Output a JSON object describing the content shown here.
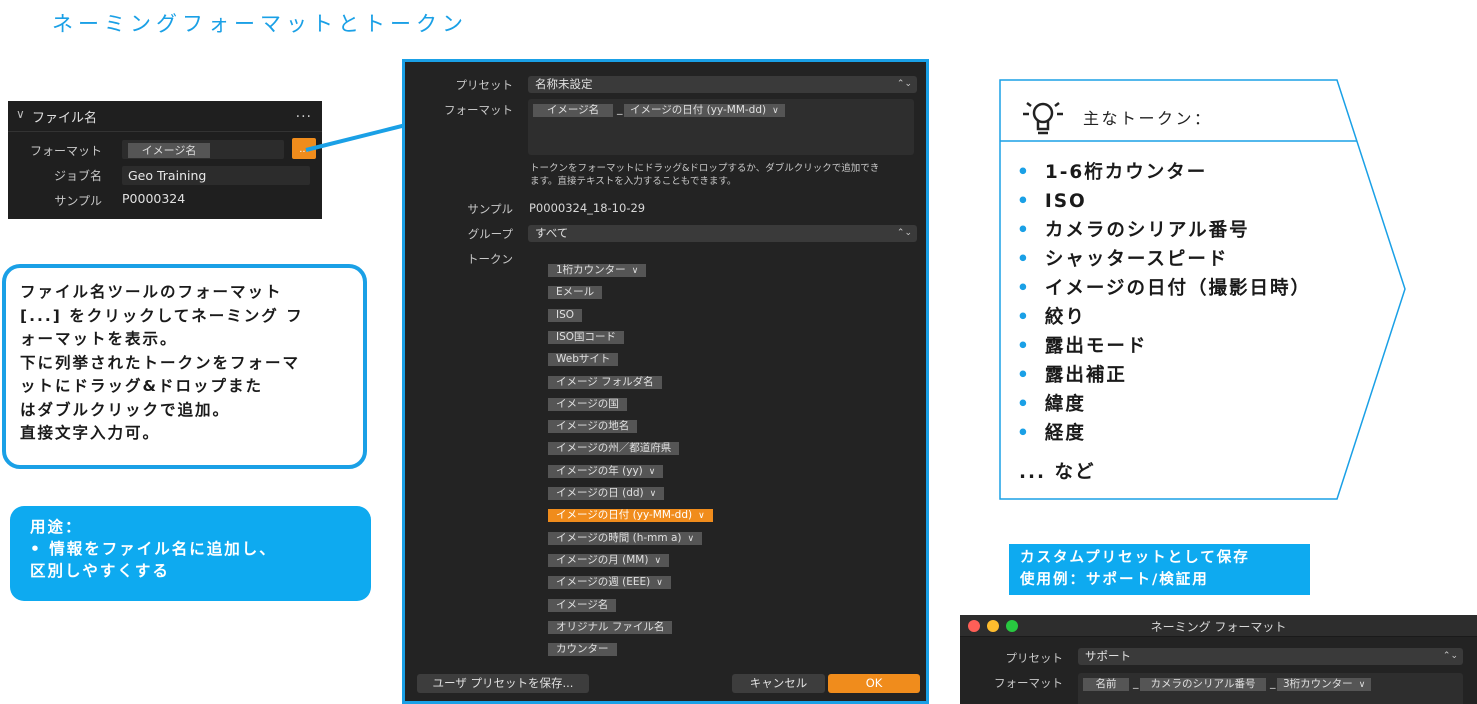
{
  "page_title": "ネーミングフォーマットとトークン",
  "file_name_panel": {
    "title": "ファイル名",
    "more": "...",
    "labels": {
      "format": "フォーマット",
      "job": "ジョブ名",
      "sample": "サンプル"
    },
    "format_token": "イメージ名",
    "job_value": "Geo Training",
    "sample_value": "P0000324",
    "dots_button": "..."
  },
  "description": {
    "lines": [
      "ファイル名ツールのフォーマット",
      "[...] をクリックしてネーミング フ",
      "ォーマットを表示。",
      "下に列挙されたトークンをフォーマ",
      "ットにドラッグ&ドロップまた",
      "はダブルクリックで追加。",
      "直接文字入力可。"
    ]
  },
  "usage": {
    "heading": "用途：",
    "items": [
      "•  情報をファイル名に追加し、",
      "    区別しやすくする"
    ]
  },
  "dialog": {
    "labels": {
      "preset": "プリセット",
      "format": "フォーマット",
      "sample": "サンプル",
      "group": "グループ",
      "tokens": "トークン"
    },
    "preset_value": "名称未設定",
    "format_tokens": [
      "イメージ名",
      "イメージの日付 (yy-MM-dd)"
    ],
    "format_separator": "_",
    "hint_lines": [
      "トークンをフォーマットにドラッグ&ドロップするか、ダブルクリックで追加でき",
      "ます。直接テキストを入力することもできます。"
    ],
    "sample_value": "P0000324_18-10-29",
    "group_value": "すべて",
    "tokens": [
      {
        "label": "1桁カウンター",
        "dropdown": true
      },
      {
        "label": "Eメール",
        "dropdown": false
      },
      {
        "label": "ISO",
        "dropdown": false
      },
      {
        "label": "ISO国コード",
        "dropdown": false
      },
      {
        "label": "Webサイト",
        "dropdown": false
      },
      {
        "label": "イメージ フォルダ名",
        "dropdown": false
      },
      {
        "label": "イメージの国",
        "dropdown": false
      },
      {
        "label": "イメージの地名",
        "dropdown": false
      },
      {
        "label": "イメージの州／都道府県",
        "dropdown": false
      },
      {
        "label": "イメージの年 (yy)",
        "dropdown": true
      },
      {
        "label": "イメージの日 (dd)",
        "dropdown": true
      },
      {
        "label": "イメージの日付 (yy-MM-dd)",
        "dropdown": true,
        "highlighted": true
      },
      {
        "label": "イメージの時間 (h-mm a)",
        "dropdown": true
      },
      {
        "label": "イメージの月 (MM)",
        "dropdown": true
      },
      {
        "label": "イメージの週 (EEE)",
        "dropdown": true
      },
      {
        "label": "イメージ名",
        "dropdown": false
      },
      {
        "label": "オリジナル ファイル名",
        "dropdown": false
      },
      {
        "label": "カウンター",
        "dropdown": false
      }
    ],
    "buttons": {
      "save_preset": "ユーザ プリセットを保存...",
      "cancel": "キャンセル",
      "ok": "OK"
    }
  },
  "tokens_callout": {
    "heading": "主なトークン：",
    "items": [
      "1-6桁カウンター",
      "ISO",
      "カメラのシリアル番号",
      "シャッタースピード",
      "イメージの日付（撮影日時）",
      "絞り",
      "露出モード",
      "露出補正",
      "緯度",
      "経度"
    ],
    "etc": "... など"
  },
  "custom_preset": {
    "lines": [
      "カスタムプリセットとして保存",
      "使用例：サポート/検証用"
    ]
  },
  "mini_window": {
    "title": "ネーミング フォーマット",
    "labels": {
      "preset": "プリセット",
      "format": "フォーマット"
    },
    "preset_value": "サポート",
    "format_tokens": [
      "名前",
      "カメラのシリアル番号",
      "3桁カウンター"
    ],
    "format_separator": "_"
  },
  "colors": {
    "accent": "#1aa0e6",
    "orange": "#f08c1c",
    "dark_bg": "#232323"
  }
}
